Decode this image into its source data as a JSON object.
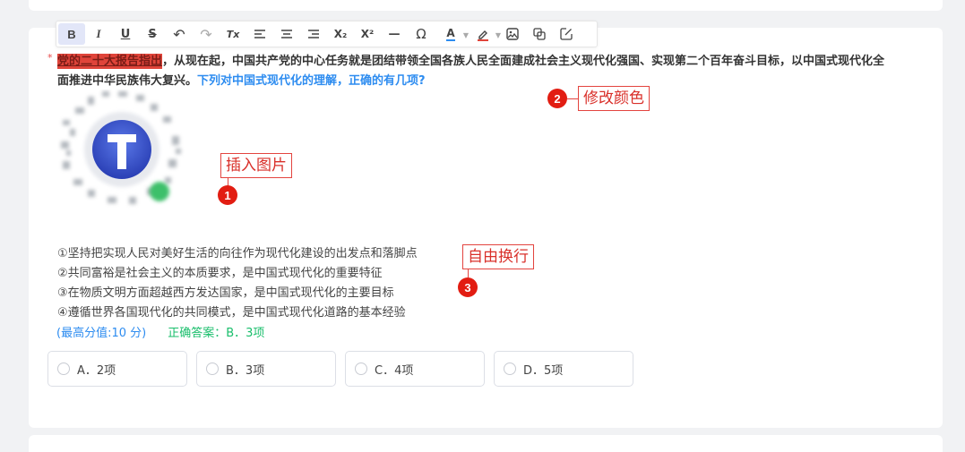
{
  "toolbar": {
    "buttons": [
      {
        "name": "bold-button",
        "icon": "bold-icon",
        "glyph": "B"
      },
      {
        "name": "italic-button",
        "icon": "italic-icon",
        "glyph": "I"
      },
      {
        "name": "underline-button",
        "icon": "underline-icon",
        "glyph": "U"
      },
      {
        "name": "strikethrough-button",
        "icon": "strikethrough-icon",
        "glyph": "S"
      },
      {
        "name": "undo-button",
        "icon": "undo-icon",
        "glyph": "↶"
      },
      {
        "name": "redo-button",
        "icon": "redo-icon",
        "glyph": "↷"
      },
      {
        "name": "clear-format-button",
        "icon": "clear-format-icon",
        "glyph": "Tx"
      },
      {
        "name": "align-left-button",
        "icon": "align-left-icon"
      },
      {
        "name": "align-center-button",
        "icon": "align-center-icon"
      },
      {
        "name": "align-right-button",
        "icon": "align-right-icon"
      },
      {
        "name": "subscript-button",
        "icon": "subscript-icon",
        "glyph": "X₂"
      },
      {
        "name": "superscript-button",
        "icon": "superscript-icon",
        "glyph": "X²"
      },
      {
        "name": "horizontal-rule-button",
        "icon": "horizontal-rule-icon",
        "glyph": "—"
      },
      {
        "name": "special-char-button",
        "icon": "omega-icon",
        "glyph": "Ω"
      },
      {
        "name": "font-color-button",
        "icon": "font-color-icon",
        "glyph": "A"
      },
      {
        "name": "highlight-color-button",
        "icon": "pen-icon"
      },
      {
        "name": "insert-image-button",
        "icon": "image-icon"
      },
      {
        "name": "copy-button",
        "icon": "copy-icon"
      },
      {
        "name": "edit-button",
        "icon": "edit-icon"
      }
    ],
    "font_color": "#2d8cf0",
    "highlight_color": "#e0443a"
  },
  "question": {
    "required_mark": "*",
    "highlighted": "党的二十大报告指出",
    "main": "，从现在起，中国共产党的中心任务就是团结带领全国各族人民全面建成社会主义现代化强国、实现第二个百年奋斗目标，以中国式现代化全面推进中华民族伟大复兴。",
    "colored": "下列对中国式现代化的理解，正确的有几项?"
  },
  "annotations": {
    "insert_image": {
      "number": "1",
      "label": "插入图片"
    },
    "change_color": {
      "number": "2",
      "label": "修改颜色"
    },
    "free_wrap": {
      "number": "3",
      "label": "自由换行"
    }
  },
  "statements": [
    "①坚持把实现人民对美好生活的向往作为现代化建设的出发点和落脚点",
    "②共同富裕是社会主义的本质要求，是中国式现代化的重要特征",
    "③在物质文明方面超越西方发达国家，是中国式现代化的主要目标",
    "④遵循世界各国现代化的共同模式，是中国式现代化道路的基本经验"
  ],
  "meta": {
    "score": "(最高分值:10 分)",
    "answer": "正确答案：B．3项"
  },
  "options": [
    {
      "label": "A．2项"
    },
    {
      "label": "B．3项"
    },
    {
      "label": "C．4项"
    },
    {
      "label": "D．5项"
    }
  ],
  "colors": {
    "accent_blue": "#2d8cf0",
    "correct_green": "#19be6b",
    "annotation_red": "#e21d12"
  }
}
